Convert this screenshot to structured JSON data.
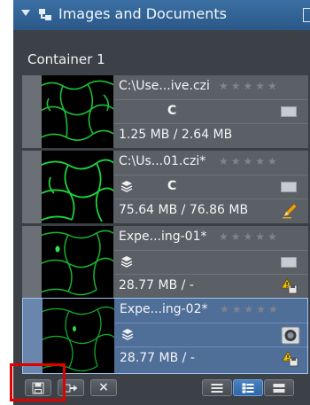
{
  "panel": {
    "title": "Images and Documents",
    "container_label": "Container 1"
  },
  "documents": [
    {
      "name": "C:\\Use...ive.czi",
      "rating_stars": "★★★★★",
      "channel_label": "C",
      "size": "1.25 MB / 2.64 MB",
      "has_layers_icon": false,
      "status_icon": "monitor-rect-icon",
      "selected": false
    },
    {
      "name": "C:\\Us...01.czi*",
      "rating_stars": "★★★★★",
      "channel_label": "C",
      "size": "75.64 MB / 76.86 MB",
      "has_layers_icon": true,
      "status_icon": "pencil-icon",
      "selected": false
    },
    {
      "name": "Expe...ing-01*",
      "rating_stars": "★★★★★",
      "channel_label": "",
      "size": "28.77 MB / -",
      "has_layers_icon": true,
      "status_icon": "warning-save-icon",
      "selected": false
    },
    {
      "name": "Expe...ing-02*",
      "rating_stars": "★★★★★",
      "channel_label": "",
      "size": "28.77 MB / -",
      "has_layers_icon": true,
      "status_icon": "warning-save-icon",
      "selected": true
    }
  ],
  "toolbar": {
    "save_button_icon": "save-disk-icon",
    "export_button_icon": "export-arrow-icon",
    "close_label": "×",
    "view_modes": [
      "list-view",
      "detail-view",
      "gallery-view"
    ],
    "active_view": "detail-view"
  },
  "colors": {
    "title_bar": "#2f5f91",
    "panel_bg": "#3c4047",
    "row_bg": "#5b5f66",
    "selected_row": "#4f6f99",
    "highlight": "#e00000",
    "thumbnail_signal": "#1fd43a"
  }
}
